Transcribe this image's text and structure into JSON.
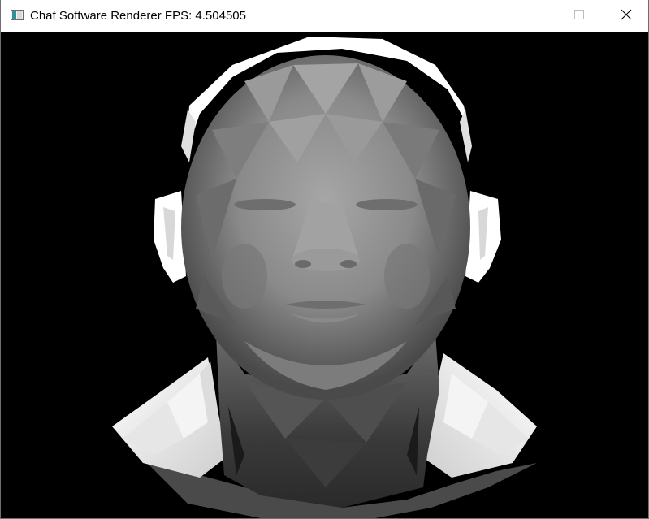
{
  "window": {
    "title": "Chaf Software Renderer FPS: 4.504505",
    "icon": "app-window-icon",
    "controls": {
      "minimize_icon": "minimize-icon",
      "maximize_icon": "maximize-icon",
      "close_icon": "close-icon"
    }
  },
  "viewport": {
    "background_color": "#000000",
    "render": "shaded-3d-head-mesh"
  },
  "colors": {
    "titlebar_bg": "#ffffff",
    "title_text": "#000000",
    "mesh_mid": "#8a8a8a",
    "mesh_highlight": "#ffffff"
  }
}
